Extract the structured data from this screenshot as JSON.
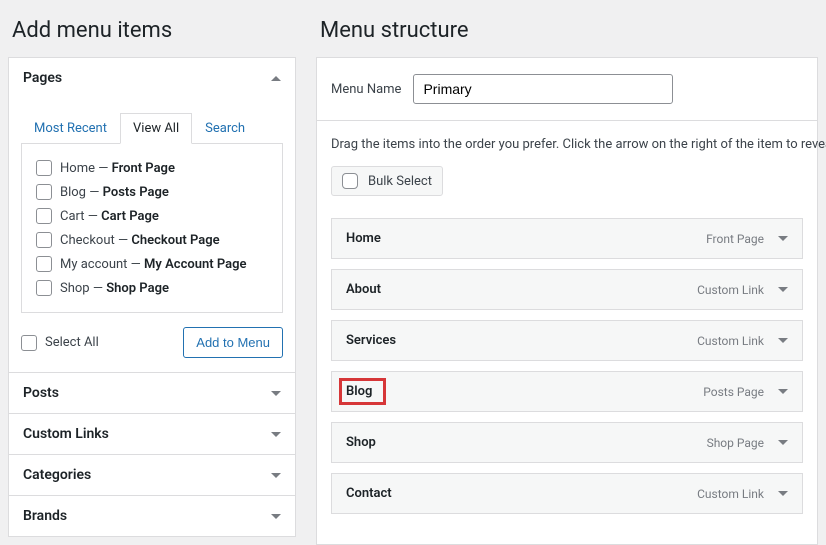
{
  "left": {
    "heading": "Add menu items",
    "acc_pages": "Pages",
    "tabs": {
      "recent": "Most Recent",
      "viewall": "View All",
      "search": "Search"
    },
    "pages": [
      {
        "label": "Home",
        "suffix": "Front Page"
      },
      {
        "label": "Blog",
        "suffix": "Posts Page"
      },
      {
        "label": "Cart",
        "suffix": "Cart Page"
      },
      {
        "label": "Checkout",
        "suffix": "Checkout Page"
      },
      {
        "label": "My account",
        "suffix": "My Account Page"
      },
      {
        "label": "Shop",
        "suffix": "Shop Page"
      }
    ],
    "select_all": "Select All",
    "add_btn": "Add to Menu",
    "acc_posts": "Posts",
    "acc_links": "Custom Links",
    "acc_cats": "Categories",
    "acc_brands": "Brands"
  },
  "right": {
    "heading": "Menu structure",
    "menu_name_label": "Menu Name",
    "menu_name_value": "Primary",
    "hint": "Drag the items into the order you prefer. Click the arrow on the right of the item to reveal additional configuration options.",
    "bulk_select": "Bulk Select",
    "items": [
      {
        "title": "Home",
        "type": "Front Page"
      },
      {
        "title": "About",
        "type": "Custom Link"
      },
      {
        "title": "Services",
        "type": "Custom Link"
      },
      {
        "title": "Blog",
        "type": "Posts Page"
      },
      {
        "title": "Shop",
        "type": "Shop Page"
      },
      {
        "title": "Contact",
        "type": "Custom Link"
      }
    ]
  },
  "dash": "—"
}
